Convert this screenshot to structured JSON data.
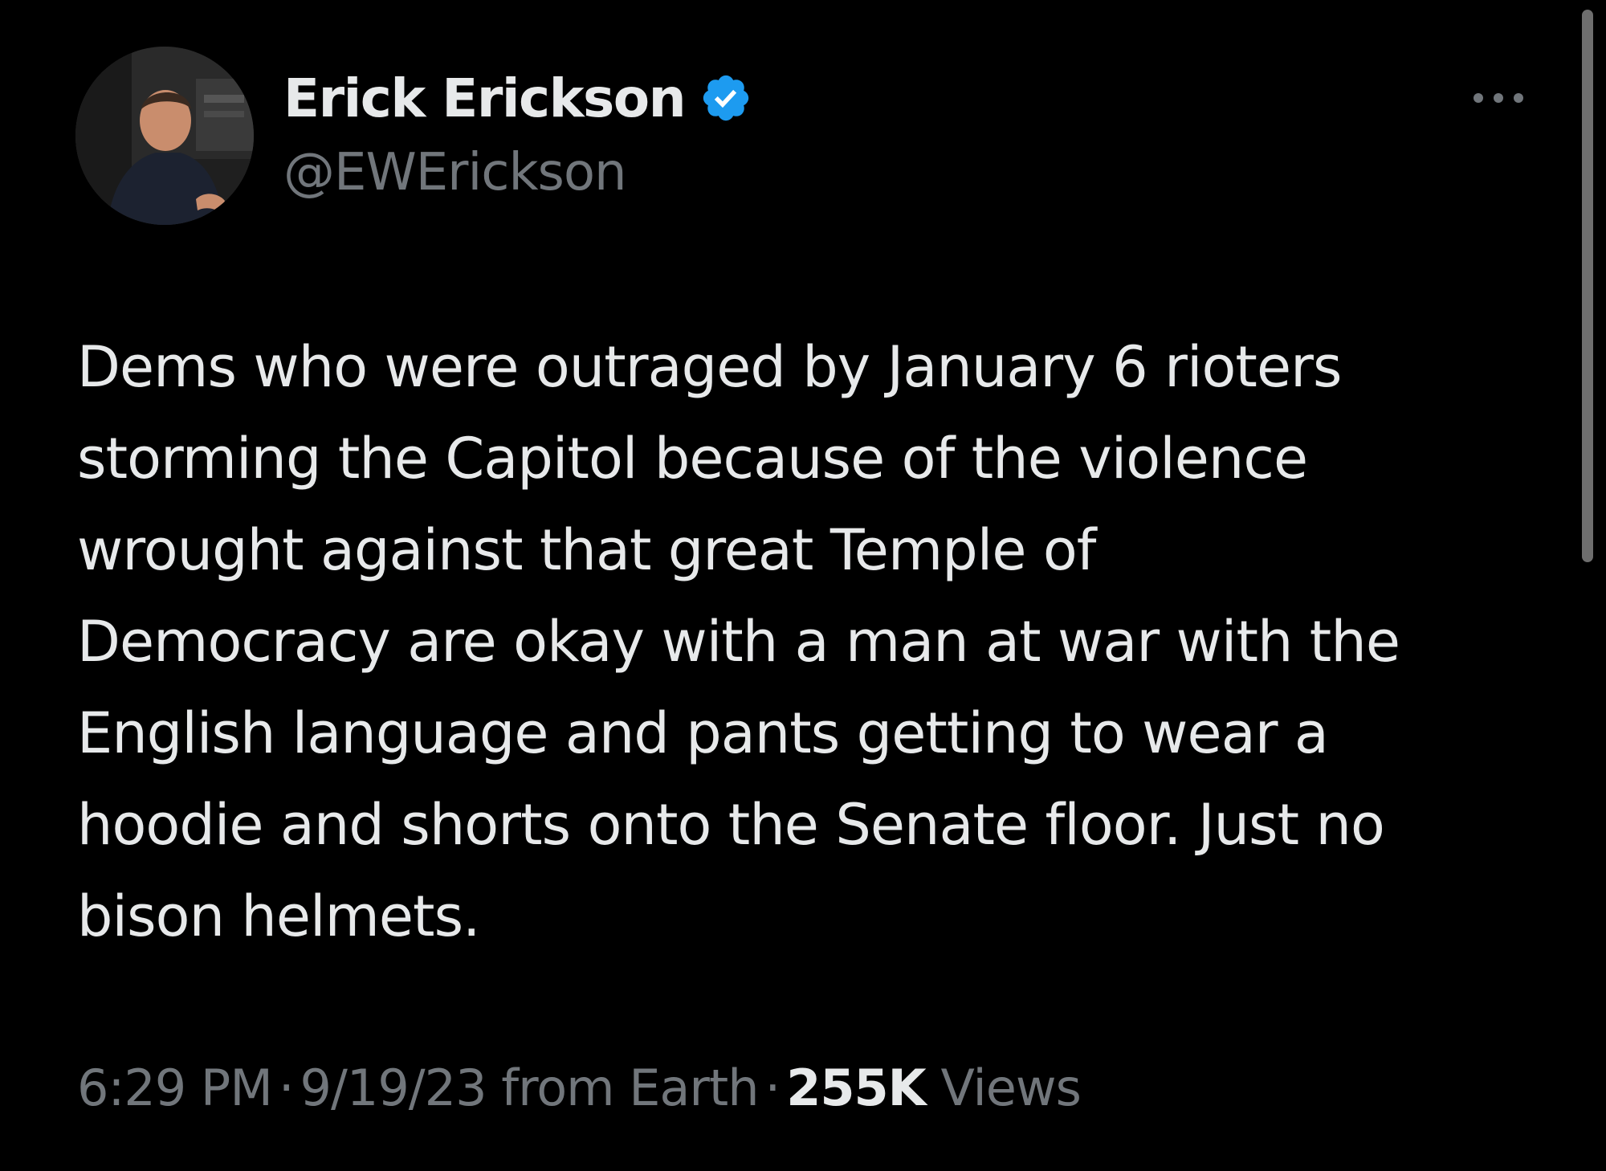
{
  "tweet": {
    "author": {
      "display_name": "Erick Erickson",
      "handle": "@EWErickson",
      "verified": true,
      "verified_color": "#1d9bf0"
    },
    "more_icon": "more-horizontal-icon",
    "text_lines": [
      "Dems who were outraged by January 6 rioters",
      "storming the Capitol because of the violence",
      "wrought against that great Temple of",
      "Democracy are okay with a man at war with the",
      "English language and pants getting to wear a",
      "hoodie and shorts onto the Senate floor. Just no",
      "bison helmets."
    ],
    "meta": {
      "time": "6:29 PM",
      "separator": "·",
      "date_source": "9/19/23 from Earth",
      "views_count": "255K",
      "views_label": "Views"
    }
  },
  "colors": {
    "background": "#000000",
    "primary_text": "#e7e9ea",
    "secondary_text": "#71767b",
    "verified_blue": "#1d9bf0"
  }
}
